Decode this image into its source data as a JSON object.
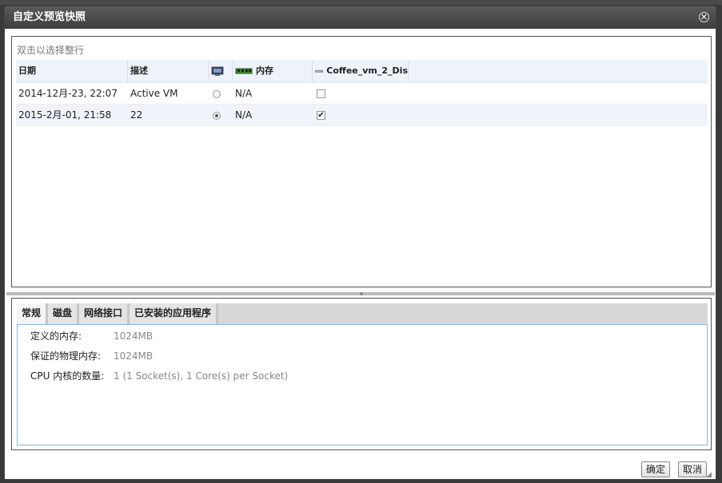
{
  "dialog": {
    "title": "自定义预览快照",
    "close_icon": "close-circle-icon"
  },
  "instruction": "双击以选择整行",
  "table": {
    "columns": {
      "date": "日期",
      "description": "描述",
      "monitor_icon": "monitor-icon",
      "memory": "内存",
      "memory_icon": "memory-chip-icon",
      "disk": "Coffee_vm_2_Dis",
      "disk_icon": "disk-drive-icon"
    },
    "rows": [
      {
        "date": "2014-12月-23, 22:07",
        "description": "Active VM",
        "state_selected": false,
        "memory": "N/A",
        "disk_checked": false
      },
      {
        "date": "2015-2月-01, 21:58",
        "description": "22",
        "state_selected": true,
        "memory": "N/A",
        "disk_checked": true
      }
    ]
  },
  "tabs": [
    {
      "label": "常规",
      "active": true
    },
    {
      "label": "磁盘",
      "active": false
    },
    {
      "label": "网络接口",
      "active": false
    },
    {
      "label": "已安装的应用程序",
      "active": false
    }
  ],
  "general": {
    "defined_memory_label": "定义的内存:",
    "defined_memory_value": "1024MB",
    "guaranteed_memory_label": "保证的物理内存:",
    "guaranteed_memory_value": "1024MB",
    "cpu_label": "CPU 内核的数量:",
    "cpu_value": "1 (1 Socket(s), 1 Core(s) per Socket)"
  },
  "buttons": {
    "ok": "确定",
    "cancel": "取消"
  },
  "colors": {
    "titlebar": "#4a4a4a",
    "header_bg": "#eef2fb",
    "tab_border": "#8fb3d0"
  }
}
